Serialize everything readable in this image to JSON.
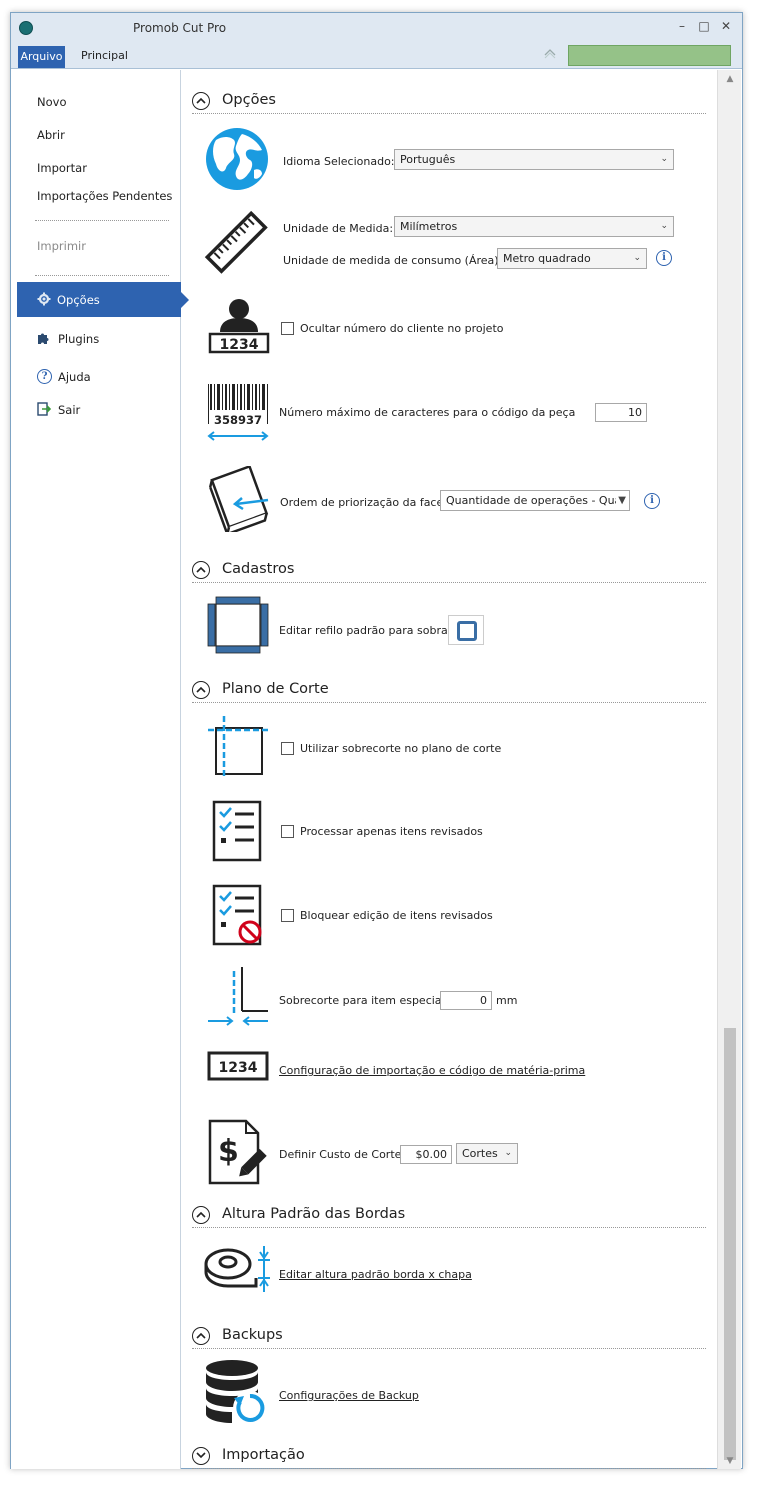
{
  "window": {
    "title": "Promob Cut Pro"
  },
  "ribbon": {
    "tabs": [
      "Arquivo",
      "Principal"
    ]
  },
  "sidebar": {
    "items": [
      "Novo",
      "Abrir",
      "Importar",
      "Importações Pendentes",
      "Imprimir",
      "Opções",
      "Plugins",
      "Ajuda",
      "Sair"
    ]
  },
  "sections": {
    "opcoes": "Opções",
    "cadastros": "Cadastros",
    "plano": "Plano de Corte",
    "altura": "Altura Padrão das Bordas",
    "backups": "Backups",
    "importacao": "Importação"
  },
  "opcoes": {
    "idioma_label": "Idioma Selecionado:",
    "idioma_value": "Português",
    "unidade_label": "Unidade de Medida:",
    "unidade_value": "Milímetros",
    "consumo_label": "Unidade de medida de consumo (Área):",
    "consumo_value": "Metro quadrado",
    "ocultar_label": "Ocultar número do cliente no projeto",
    "cliente_num": "1234",
    "max_label": "Número máximo de caracteres para o código da peça",
    "max_value": "10",
    "barcode_num": "358937",
    "ordem_label": "Ordem de priorização da face:",
    "ordem_value": "Quantidade de operações - Qua"
  },
  "cadastros": {
    "refilo_label": "Editar refilo padrão para sobras"
  },
  "plano": {
    "sobrecorte_label": "Utilizar sobrecorte no plano de corte",
    "processar_label": "Processar apenas itens revisados",
    "bloquear_label": "Bloquear edição de itens revisados",
    "especial_label": "Sobrecorte para item especial",
    "especial_value": "0",
    "especial_unit": "mm",
    "config_link": "Configuração de importação e código de matéria-prima",
    "code_num": "1234",
    "custo_label": "Definir Custo de Corte",
    "custo_value": "$0.00",
    "custo_unit": "Cortes"
  },
  "altura": {
    "link": "Editar altura padrão borda x chapa"
  },
  "backups": {
    "link": "Configurações de Backup"
  },
  "icons": {
    "logo": "app-logo-icon",
    "globe": "globe-icon",
    "ruler": "ruler-icon",
    "person": "client-icon",
    "barcode": "barcode-icon",
    "book": "book-arrow-icon",
    "refilo": "refilo-icon",
    "accent": "#2e63b0",
    "cyan": "#1a9be0"
  }
}
